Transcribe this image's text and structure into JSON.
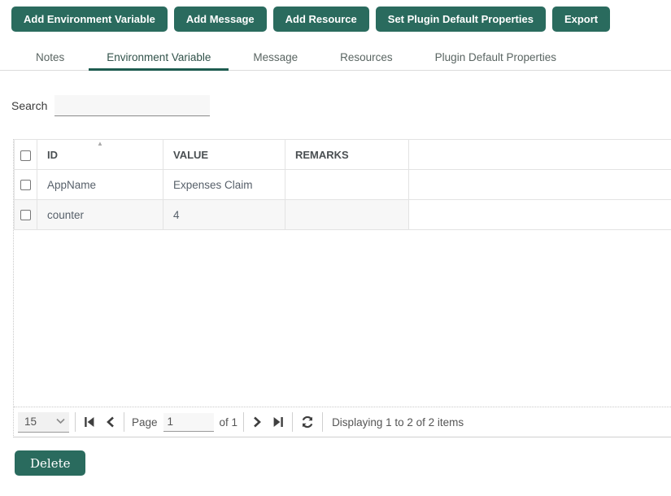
{
  "theme": {
    "accent": "#2a6b5e",
    "accent_underline": "#1e5c50",
    "row_alt_bg": "#f7f7f7",
    "border_light": "#e3e3e3"
  },
  "toolbar_buttons": [
    {
      "label": "Add Environment Variable"
    },
    {
      "label": "Add Message"
    },
    {
      "label": "Add Resource"
    },
    {
      "label": "Set Plugin Default Properties"
    },
    {
      "label": "Export"
    }
  ],
  "tabs": [
    {
      "label": "Notes",
      "active": false
    },
    {
      "label": "Environment Variable",
      "active": true
    },
    {
      "label": "Message",
      "active": false
    },
    {
      "label": "Resources",
      "active": false
    },
    {
      "label": "Plugin Default Properties",
      "active": false
    }
  ],
  "search": {
    "label": "Search",
    "value": ""
  },
  "grid": {
    "columns": [
      {
        "label": "ID",
        "sorted": "ascending"
      },
      {
        "label": "VALUE",
        "sorted": ""
      },
      {
        "label": "REMARKS",
        "sorted": ""
      }
    ],
    "rows": [
      {
        "id": "AppName",
        "value": "Expenses Claim",
        "remarks": "",
        "checked": false
      },
      {
        "id": "counter",
        "value": "4",
        "remarks": "",
        "checked": false
      }
    ]
  },
  "pagination": {
    "page_size": "15",
    "page_label": "Page",
    "page_value": "1",
    "of_label": "of 1",
    "status": "Displaying 1 to 2 of 2 items"
  },
  "icons": {
    "sort_ascending": "▲",
    "chevron_down": "svg:chevron-down",
    "first_page": "svg:bar-left-triangle",
    "previous_page": "svg:chevron-left",
    "next_page": "svg:chevron-right",
    "last_page": "svg:bar-right-triangle",
    "refresh": "svg:circular-arrows"
  },
  "actions": {
    "delete_label": "Delete"
  }
}
